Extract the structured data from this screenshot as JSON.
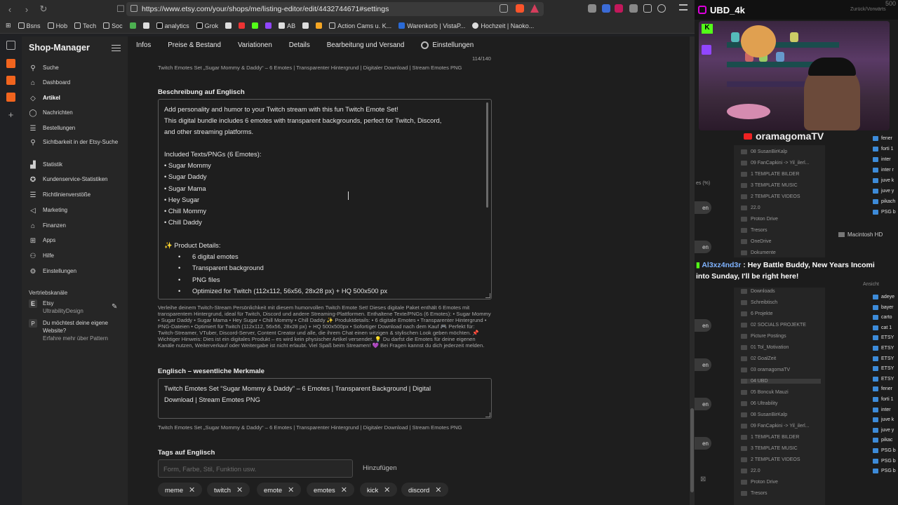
{
  "browser": {
    "url": "https://www.etsy.com/your/shops/me/listing-editor/edit/4432744671#settings",
    "bookmarks": [
      "Bsns",
      "Hob",
      "Tech",
      "Soc",
      "analytics",
      "Grok",
      "AB",
      "Action Cams u. K...",
      "Warenkorb | VistaP...",
      "Hochzeit | Naoko..."
    ]
  },
  "sidebar": {
    "title": "Shop-Manager",
    "items": [
      {
        "label": "Suche",
        "icon": "search-icon"
      },
      {
        "label": "Dashboard",
        "icon": "home-icon"
      },
      {
        "label": "Artikel",
        "icon": "tag-icon"
      },
      {
        "label": "Nachrichten",
        "icon": "chat-icon"
      },
      {
        "label": "Bestellungen",
        "icon": "list-icon"
      },
      {
        "label": "Sichtbarkeit in der Etsy-Suche",
        "icon": "magnifier-icon"
      },
      {
        "label": "Statistik",
        "icon": "chart-icon"
      },
      {
        "label": "Kundenservice-Statistiken",
        "icon": "star-icon"
      },
      {
        "label": "Richtlinienverstöße",
        "icon": "list-icon"
      },
      {
        "label": "Marketing",
        "icon": "megaphone-icon"
      },
      {
        "label": "Finanzen",
        "icon": "bank-icon"
      },
      {
        "label": "Apps",
        "icon": "grid-icon"
      },
      {
        "label": "Hilfe",
        "icon": "people-icon"
      },
      {
        "label": "Einstellungen",
        "icon": "gear-icon"
      }
    ],
    "channels_heading": "Vertriebskanäle",
    "etsy_channel": {
      "name": "Etsy",
      "shop": "UltrabilityDesign"
    },
    "pattern_promo": {
      "text": "Du möchtest deine eigene Website?",
      "sub": "Erfahre mehr über Pattern"
    }
  },
  "tabs": [
    "Infos",
    "Preise & Bestand",
    "Variationen",
    "Details",
    "Bearbeitung und Versand",
    "Einstellungen"
  ],
  "editor": {
    "char_count": "114/140",
    "title_preview": "Twitch Emotes Set „Sugar Mommy & Daddy“ – 6 Emotes | Transparenter Hintergrund | Digitaler Download | Stream Emotes PNG",
    "desc_heading": "Beschreibung auf Englisch",
    "desc_lines": [
      "Add personality and humor to your Twitch stream with this fun Twitch Emote Set!",
      "This digital bundle includes 6 emotes with transparent backgrounds, perfect for Twitch, Discord,",
      "and other streaming platforms.",
      "",
      "Included Texts/PNGs (6 Emotes):",
      "• Sugar Mommy",
      "• Sugar Daddy",
      "• Sugar Mama",
      "• Hey Sugar",
      "• Chill Mommy",
      "• Chill Daddy",
      "",
      "✨ Product Details:"
    ],
    "desc_bullets": [
      "6 digital emotes",
      "Transparent background",
      "PNG files",
      "Optimized for Twitch (112x112, 56x56, 28x28 px) + HQ 500x500 px"
    ],
    "desc_translation": "Verleihe deinem Twitch-Stream Persönlichkeit mit diesem humorvollen Twitch Emote Set! Dieses digitale Paket enthält 6 Emotes mit transparentem Hintergrund, ideal für Twitch, Discord und andere Streaming-Plattformen. Enthaltene Texte/PNGs (6 Emotes): • Sugar Mommy • Sugar Daddy • Sugar Mama • Hey Sugar • Chill Mommy • Chill Daddy ✨ Produktdetails: • 6 digitale Emotes • Transparenter Hintergrund • PNG-Dateien • Optimiert für Twitch (112x112, 56x56, 28x28 px) + HQ 500x500px • Sofortiger Download nach dem Kauf 🎮 Perfekt für: Twitch-Streamer, VTuber, Discord-Server, Content Creator und alle, die ihrem Chat einen witzigen & stylischen Look geben möchten. 📌 Wichtiger Hinweis: Dies ist ein digitales Produkt – es wird kein physischer Artikel versendet. 💡 Du darfst die Emotes für deine eigenen Kanäle nutzen, Weiterverkauf oder Weitergabe ist nicht erlaubt. Viel Spaß beim Streamen! 💜 Bei Fragen kannst du dich jederzeit melden.",
    "features_heading": "Englisch – wesentliche Merkmale",
    "features_lines": [
      "Twitch Emotes Set “Sugar Mommy & Daddy” – 6 Emotes | Transparent Background | Digital",
      "Download | Stream Emotes PNG"
    ],
    "features_translation": "Twitch Emotes Set „Sugar Mommy & Daddy“ – 6 Emotes | Transparenter Hintergrund | Digitaler Download | Stream Emotes PNG",
    "tags_heading": "Tags auf Englisch",
    "tag_placeholder": "Form, Farbe, Stil, Funktion usw.",
    "add_label": "Hinzufügen",
    "tags": [
      "meme",
      "twitch",
      "emote",
      "emotes",
      "kick",
      "discord"
    ]
  },
  "overlay": {
    "channel": "UBD_4k",
    "youtube_name": "oramagomaTV",
    "chat_user": "Al3xz4nd3r",
    "chat_text_1": "Hey Battle Buddy, New Years Incomi",
    "chat_text_2": "into Sunday, I'll be right here!",
    "finder_items": [
      "08 SusanBirKalp",
      "09 FanCapkini -> Yil_ilerl...",
      "1 TEMPLATE BILDER",
      "3 TEMPLATE MUSIC",
      "2 TEMPLATE VIDEOS",
      "22.0",
      "Proton Drive",
      "Tresors",
      "OneDrive",
      "Dokumente"
    ],
    "finder_items_2": [
      "Downloads",
      "Schreibtisch",
      "6 Projekte",
      "02 SOCIALS PROJEKTE",
      "Picture Postings",
      "01 Tol_Motivation",
      "02 GoalZeit",
      "03 oramagomaTV",
      "04 UBD",
      "05 Boncuk Mauzi",
      "06 Ultrability",
      "08 SusanBirKalp",
      "09 FanCapkini -> Yil_ilerl...",
      "1 TEMPLATE BILDER",
      "3 TEMPLATE MUSIC",
      "2 TEMPLATE VIDEOS",
      "22.0",
      "Proton Drive",
      "Tresors"
    ],
    "blue_items": [
      "fener",
      "forti 1",
      "inter",
      "inter r",
      "juve k",
      "juve y",
      "pikach",
      "PSG b"
    ],
    "blue_items_2": [
      "adeye",
      "bayer",
      "carto",
      "cat 1",
      "ETSY",
      "ETSY",
      "ETSY",
      "ETSY",
      "ETSY",
      "fener",
      "forti 1",
      "inter",
      "juve k",
      "juve y",
      "pikac",
      "PSG b",
      "PSG b",
      "PSG b"
    ],
    "macintosh": "Macintosh HD",
    "zuruck": "Zurück/Vorwärts",
    "ansicht": "Ansicht",
    "percent": "es (%)",
    "pill_label": "en",
    "count_top": "500"
  }
}
